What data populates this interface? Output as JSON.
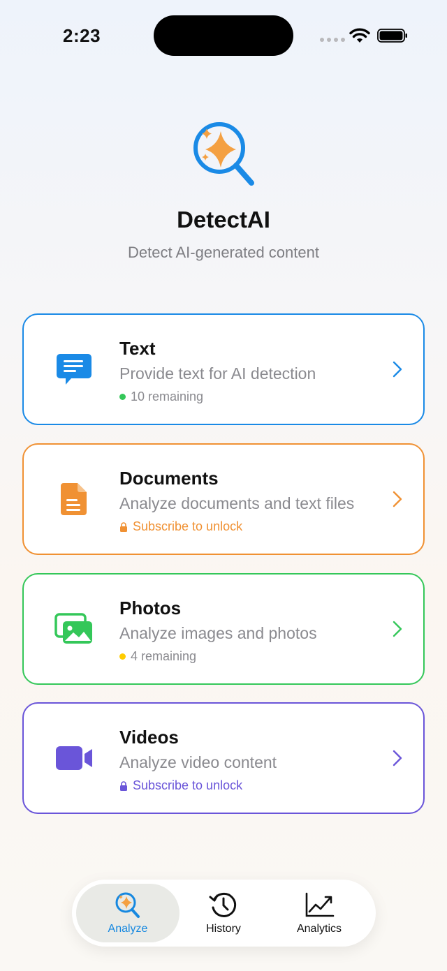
{
  "status_bar": {
    "time": "2:23"
  },
  "header": {
    "title": "DetectAI",
    "subtitle": "Detect AI-generated content",
    "logo_icon": "sparkle-magnifier-icon"
  },
  "cards": [
    {
      "title": "Text",
      "description": "Provide text for AI detection",
      "status": "10 remaining",
      "status_kind": "remaining",
      "accent": "#1a8ae6",
      "status_color": "#8a8a8f",
      "dot_color": "#34c759",
      "icon": "chat-bubble-icon"
    },
    {
      "title": "Documents",
      "description": "Analyze documents and text files",
      "status": "Subscribe to unlock",
      "status_kind": "locked",
      "accent": "#f09133",
      "status_color": "#f09133",
      "icon": "document-icon"
    },
    {
      "title": "Photos",
      "description": "Analyze images and photos",
      "status": "4 remaining",
      "status_kind": "remaining",
      "accent": "#34c759",
      "status_color": "#8a8a8f",
      "dot_color": "#ffcc00",
      "icon": "photos-icon"
    },
    {
      "title": "Videos",
      "description": "Analyze video content",
      "status": "Subscribe to unlock",
      "status_kind": "locked",
      "accent": "#6a55d9",
      "status_color": "#6a55d9",
      "icon": "video-camera-icon"
    }
  ],
  "tabs": [
    {
      "label": "Analyze",
      "active": true,
      "icon": "sparkle-magnifier-icon"
    },
    {
      "label": "History",
      "active": false,
      "icon": "history-clock-icon"
    },
    {
      "label": "Analytics",
      "active": false,
      "icon": "chart-line-icon"
    }
  ]
}
